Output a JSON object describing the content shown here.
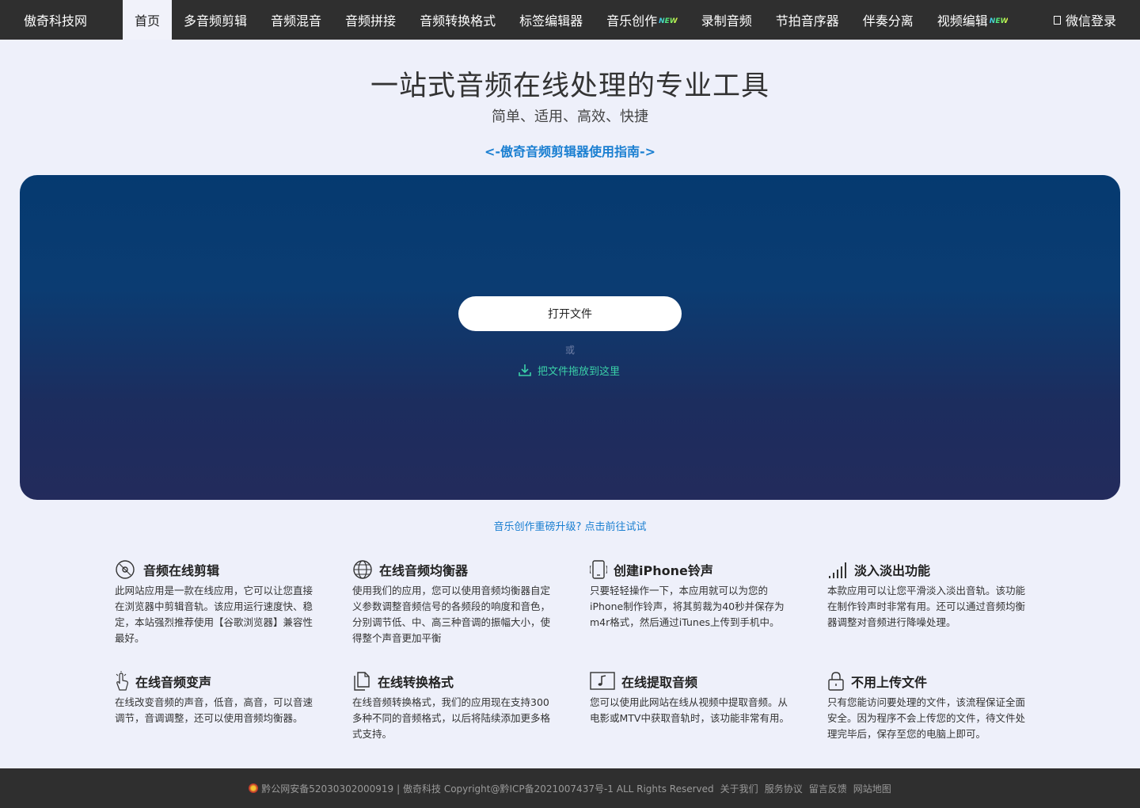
{
  "nav": {
    "brand": "傲奇科技网",
    "items": [
      {
        "label": "首页",
        "active": true,
        "new": false
      },
      {
        "label": "多音频剪辑",
        "active": false,
        "new": false
      },
      {
        "label": "音频混音",
        "active": false,
        "new": false
      },
      {
        "label": "音频拼接",
        "active": false,
        "new": false
      },
      {
        "label": "音频转换格式",
        "active": false,
        "new": false
      },
      {
        "label": "标签编辑器",
        "active": false,
        "new": false
      },
      {
        "label": "音乐创作",
        "active": false,
        "new": true
      },
      {
        "label": "录制音频",
        "active": false,
        "new": false
      },
      {
        "label": "节拍音序器",
        "active": false,
        "new": false
      },
      {
        "label": "伴奏分离",
        "active": false,
        "new": false
      },
      {
        "label": "视频编辑",
        "active": false,
        "new": true
      }
    ],
    "new_badge": "NEW",
    "login_label": "微信登录"
  },
  "hero": {
    "title": "一站式音频在线处理的专业工具",
    "subtitle": "简单、适用、高效、快捷",
    "guide_link": "<-傲奇音频剪辑器使用指南->"
  },
  "drop_panel": {
    "open_button": "打开文件",
    "or_text": "或",
    "drop_hint": "把文件拖放到这里"
  },
  "upgrade_link": "音乐创作重磅升级? 点击前往试试",
  "features": [
    {
      "icon": "disc-icon",
      "title": "音频在线剪辑",
      "desc": "此网站应用是一款在线应用，它可以让您直接在浏览器中剪辑音轨。该应用运行速度快、稳定，本站强烈推荐使用【谷歌浏览器】兼容性最好。"
    },
    {
      "icon": "globe-icon",
      "title": "在线音频均衡器",
      "desc": "使用我们的应用，您可以使用音频均衡器自定义参数调整音频信号的各频段的响度和音色，分别调节低、中、高三种音调的振幅大小，使得整个声音更加平衡"
    },
    {
      "icon": "phone-icon",
      "title": "创建iPhone铃声",
      "desc": "只要轻轻操作一下，本应用就可以为您的iPhone制作铃声，将其剪裁为40秒并保存为m4r格式，然后通过iTunes上传到手机中。"
    },
    {
      "icon": "signal-bars-icon",
      "title": "淡入淡出功能",
      "desc": "本款应用可以让您平滑淡入淡出音轨。该功能在制作铃声时非常有用。还可以通过音频均衡器调整对音频进行降噪处理。"
    },
    {
      "icon": "hand-pointer-icon",
      "title": "在线音频变声",
      "desc": "在线改变音频的声音，低音，高音，可以音速调节，音调调整，还可以使用音频均衡器。"
    },
    {
      "icon": "copy-files-icon",
      "title": "在线转换格式",
      "desc": "在线音频转换格式，我们的应用现在支持300多种不同的音频格式，以后将陆续添加更多格式支持。"
    },
    {
      "icon": "music-screen-icon",
      "title": "在线提取音频",
      "desc": "您可以使用此网站在线从视频中提取音频。从电影或MTV中获取音轨时，该功能非常有用。"
    },
    {
      "icon": "lock-icon",
      "title": "不用上传文件",
      "desc": "只有您能访问要处理的文件，该流程保证全面安全。因为程序不会上传您的文件，待文件处理完毕后，保存至您的电脑上即可。"
    }
  ],
  "footer": {
    "police": "黔公网安备52030302000919",
    "copyright": "| 傲奇科技 Copyright@黔ICP备2021007437号-1 ALL Rights Reserved",
    "links": [
      "关于我们",
      "服务协议",
      "留言反馈",
      "网站地图"
    ]
  },
  "colors": {
    "nav_bg": "#2f2f2f",
    "link_blue": "#1a7fd1",
    "drop_hint_green": "#3ad0a8",
    "panel_top": "#053a70",
    "panel_bottom": "#232b5c"
  }
}
